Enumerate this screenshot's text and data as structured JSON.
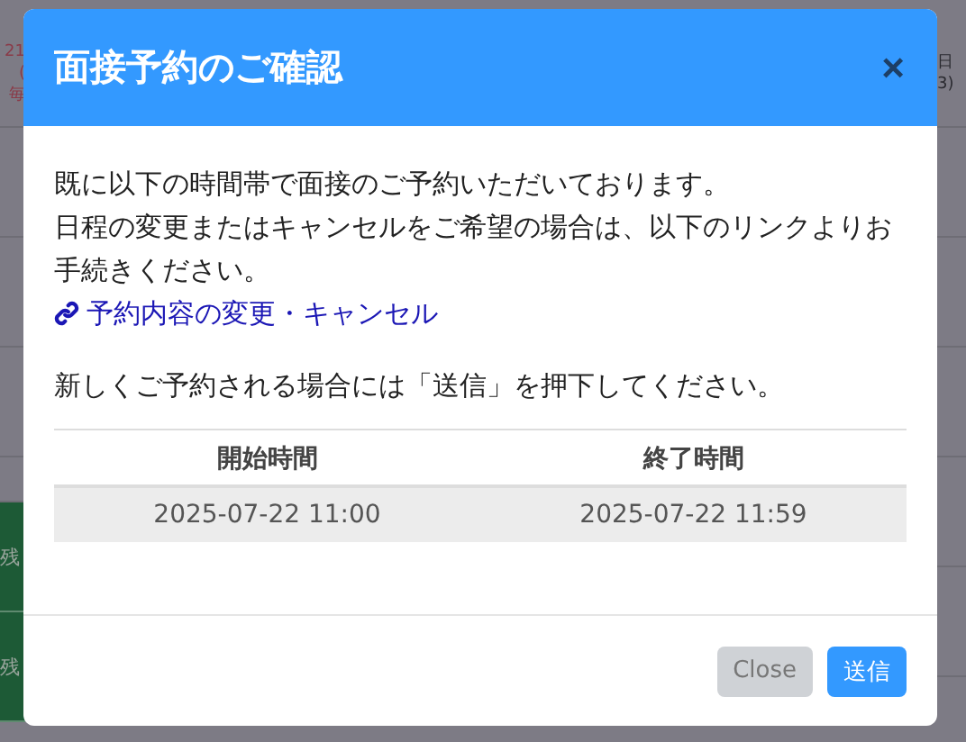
{
  "background": {
    "left_header": [
      "21",
      "(",
      "毎"
    ],
    "right_header": [
      "日",
      "3)"
    ],
    "left_cells": [
      "残",
      "残"
    ]
  },
  "modal": {
    "title": "面接予約のご確認",
    "close_icon": "×",
    "message": [
      "既に以下の時間帯で面接のご予約いただいております。",
      "日程の変更またはキャンセルをご希望の場合は、以下のリンクよりお手続きください。"
    ],
    "link": "予約内容の変更・キャンセル",
    "note": "新しくご予約される場合には「送信」を押下してください。",
    "table": {
      "columns": [
        "開始時間",
        "終了時間"
      ],
      "rows": [
        [
          "2025-07-22 11:00",
          "2025-07-22 11:59"
        ]
      ]
    },
    "buttons": [
      {
        "label": "Close",
        "kind": "secondary"
      },
      {
        "label": "送信",
        "kind": "primary"
      }
    ]
  }
}
